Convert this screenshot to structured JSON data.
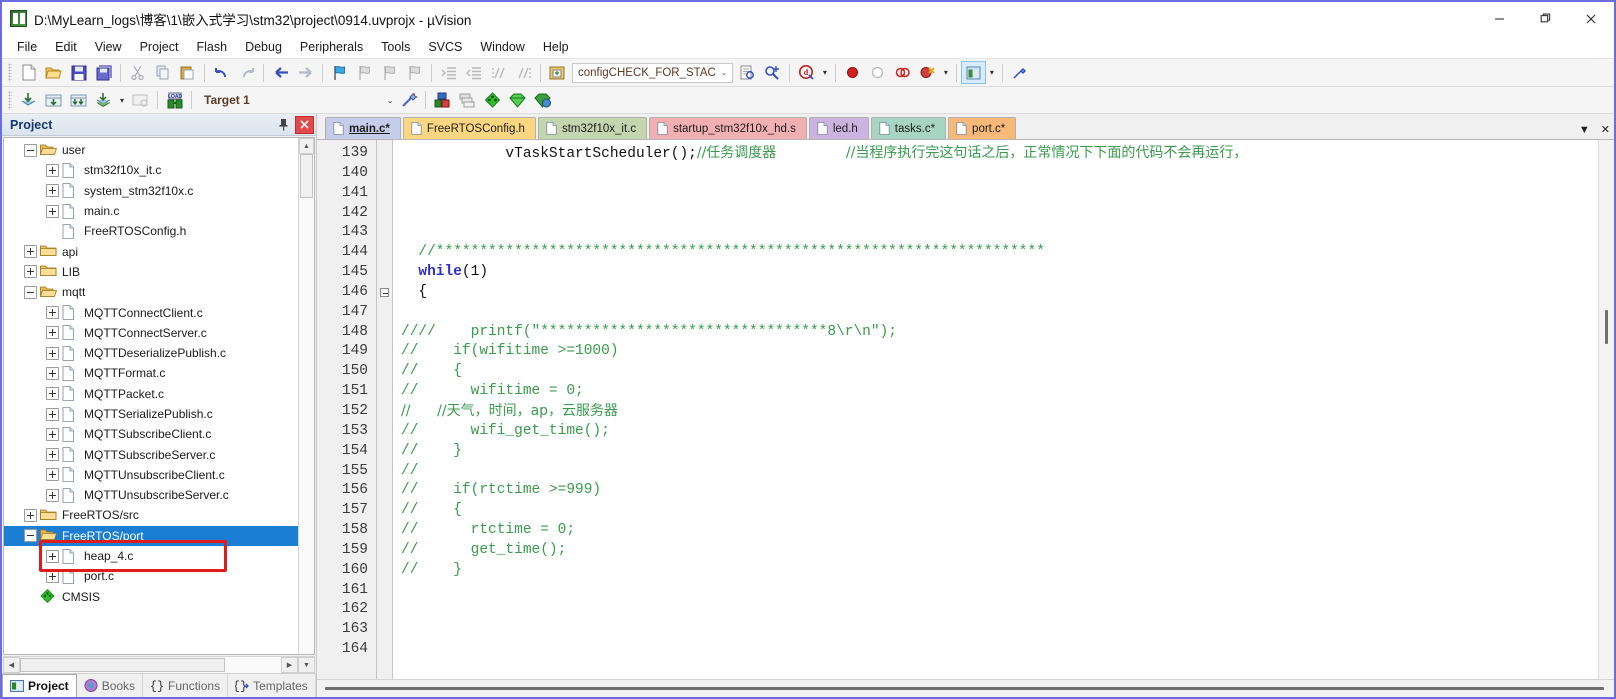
{
  "window": {
    "title": "D:\\MyLearn_logs\\博客\\1\\嵌入式学习\\stm32\\project\\0914.uvprojx - µVision",
    "app_icon": "uvision-icon",
    "minimize": "—",
    "maximize": "❐",
    "close": "✕"
  },
  "menubar": {
    "items": [
      "File",
      "Edit",
      "View",
      "Project",
      "Flash",
      "Debug",
      "Peripherals",
      "Tools",
      "SVCS",
      "Window",
      "Help"
    ]
  },
  "toolbar": {
    "combo_value": "configCHECK_FOR_STAC",
    "combo_arrow": "⌄",
    "target_value": "Target 1",
    "target_arrow": "⌄"
  },
  "project_panel": {
    "title": "Project",
    "pin_icon": "pin-icon",
    "close_icon": "close-icon",
    "tabs": [
      {
        "label": "Project",
        "icon": "project-icon",
        "active": true
      },
      {
        "label": "Books",
        "icon": "books-icon",
        "active": false
      },
      {
        "label": "Functions",
        "icon": "functions-icon",
        "active": false
      },
      {
        "label": "Templates",
        "icon": "templates-icon",
        "active": false
      }
    ],
    "tree": [
      {
        "label": "user",
        "type": "folder",
        "depth": 1,
        "state": "expanded",
        "selected": false
      },
      {
        "label": "stm32f10x_it.c",
        "type": "file",
        "depth": 2,
        "state": "collapsed",
        "selected": false
      },
      {
        "label": "system_stm32f10x.c",
        "type": "file",
        "depth": 2,
        "state": "collapsed",
        "selected": false
      },
      {
        "label": "main.c",
        "type": "file",
        "depth": 2,
        "state": "collapsed",
        "selected": false
      },
      {
        "label": "FreeRTOSConfig.h",
        "type": "file",
        "depth": 2,
        "state": "leaf",
        "selected": false
      },
      {
        "label": "api",
        "type": "folder",
        "depth": 1,
        "state": "collapsed",
        "selected": false
      },
      {
        "label": "LIB",
        "type": "folder",
        "depth": 1,
        "state": "collapsed",
        "selected": false
      },
      {
        "label": "mqtt",
        "type": "folder",
        "depth": 1,
        "state": "expanded",
        "selected": false
      },
      {
        "label": "MQTTConnectClient.c",
        "type": "file",
        "depth": 2,
        "state": "collapsed",
        "selected": false
      },
      {
        "label": "MQTTConnectServer.c",
        "type": "file",
        "depth": 2,
        "state": "collapsed",
        "selected": false
      },
      {
        "label": "MQTTDeserializePublish.c",
        "type": "file",
        "depth": 2,
        "state": "collapsed",
        "selected": false
      },
      {
        "label": "MQTTFormat.c",
        "type": "file",
        "depth": 2,
        "state": "collapsed",
        "selected": false
      },
      {
        "label": "MQTTPacket.c",
        "type": "file",
        "depth": 2,
        "state": "collapsed",
        "selected": false
      },
      {
        "label": "MQTTSerializePublish.c",
        "type": "file",
        "depth": 2,
        "state": "collapsed",
        "selected": false
      },
      {
        "label": "MQTTSubscribeClient.c",
        "type": "file",
        "depth": 2,
        "state": "collapsed",
        "selected": false
      },
      {
        "label": "MQTTSubscribeServer.c",
        "type": "file",
        "depth": 2,
        "state": "collapsed",
        "selected": false
      },
      {
        "label": "MQTTUnsubscribeClient.c",
        "type": "file",
        "depth": 2,
        "state": "collapsed",
        "selected": false
      },
      {
        "label": "MQTTUnsubscribeServer.c",
        "type": "file",
        "depth": 2,
        "state": "collapsed",
        "selected": false
      },
      {
        "label": "FreeRTOS/src",
        "type": "folder",
        "depth": 1,
        "state": "collapsed",
        "selected": false
      },
      {
        "label": "FreeRTOS/port",
        "type": "folder",
        "depth": 1,
        "state": "expanded",
        "selected": true
      },
      {
        "label": "heap_4.c",
        "type": "file",
        "depth": 2,
        "state": "collapsed",
        "selected": false,
        "annotated": true
      },
      {
        "label": "port.c",
        "type": "file",
        "depth": 2,
        "state": "collapsed",
        "selected": false
      },
      {
        "label": "CMSIS",
        "type": "cmsis",
        "depth": 1,
        "state": "leaf",
        "selected": false
      }
    ]
  },
  "editor": {
    "tabs": [
      {
        "label": "main.c*",
        "color": "#c6cdea",
        "active": true
      },
      {
        "label": "FreeRTOSConfig.h",
        "color": "#fcd681",
        "active": false
      },
      {
        "label": "stm32f10x_it.c",
        "color": "#c3d6b0",
        "active": false
      },
      {
        "label": "startup_stm32f10x_hd.s",
        "color": "#f3b0b3",
        "active": false
      },
      {
        "label": "led.h",
        "color": "#ccb3e0",
        "active": false
      },
      {
        "label": "tasks.c*",
        "color": "#a8d4c4",
        "active": false
      },
      {
        "label": "port.c*",
        "color": "#f7b878",
        "active": false
      }
    ],
    "tabstrip_dropdown": "▼",
    "tabstrip_close": "✕",
    "first_line_number": 139,
    "lines": [
      {
        "n": 139,
        "fold": false,
        "tokens": [
          {
            "t": "            ",
            "c": "txt"
          },
          {
            "t": "vTaskStartScheduler();",
            "c": "txt"
          },
          {
            "t": "//任务调度器",
            "c": "cmt"
          },
          {
            "t": "        ",
            "c": "txt"
          },
          {
            "t": "//当程序执行完这句话之后，正常情况下下面的代码不会再运行，",
            "c": "cmt"
          }
        ]
      },
      {
        "n": 140,
        "fold": false,
        "tokens": []
      },
      {
        "n": 141,
        "fold": false,
        "tokens": []
      },
      {
        "n": 142,
        "fold": false,
        "tokens": []
      },
      {
        "n": 143,
        "fold": false,
        "tokens": []
      },
      {
        "n": 144,
        "fold": false,
        "tokens": [
          {
            "t": "  //**********************************************************************",
            "c": "cmt"
          }
        ]
      },
      {
        "n": 145,
        "fold": false,
        "tokens": [
          {
            "t": "  ",
            "c": "txt"
          },
          {
            "t": "while",
            "c": "kw"
          },
          {
            "t": "(1)",
            "c": "txt"
          }
        ]
      },
      {
        "n": 146,
        "fold": true,
        "tokens": [
          {
            "t": "  {",
            "c": "txt"
          }
        ]
      },
      {
        "n": 147,
        "fold": false,
        "tokens": []
      },
      {
        "n": 148,
        "fold": false,
        "tokens": [
          {
            "t": "////    printf(\"*********************************8\\r\\n\");",
            "c": "cmt"
          }
        ]
      },
      {
        "n": 149,
        "fold": false,
        "tokens": [
          {
            "t": "//    if(wifitime >=1000)",
            "c": "cmt"
          }
        ]
      },
      {
        "n": 150,
        "fold": false,
        "tokens": [
          {
            "t": "//    {",
            "c": "cmt"
          }
        ]
      },
      {
        "n": 151,
        "fold": false,
        "tokens": [
          {
            "t": "//      wifitime = 0;",
            "c": "cmt"
          }
        ]
      },
      {
        "n": 152,
        "fold": false,
        "tokens": [
          {
            "t": "//      //天气，时间，ap，云服务器",
            "c": "cmt"
          }
        ]
      },
      {
        "n": 153,
        "fold": false,
        "tokens": [
          {
            "t": "//      wifi_get_time();",
            "c": "cmt"
          }
        ]
      },
      {
        "n": 154,
        "fold": false,
        "tokens": [
          {
            "t": "//    }",
            "c": "cmt"
          }
        ]
      },
      {
        "n": 155,
        "fold": false,
        "tokens": [
          {
            "t": "//",
            "c": "cmt"
          }
        ]
      },
      {
        "n": 156,
        "fold": false,
        "tokens": [
          {
            "t": "//    if(rtctime >=999)",
            "c": "cmt"
          }
        ]
      },
      {
        "n": 157,
        "fold": false,
        "tokens": [
          {
            "t": "//    {",
            "c": "cmt"
          }
        ]
      },
      {
        "n": 158,
        "fold": false,
        "tokens": [
          {
            "t": "//      rtctime = 0;",
            "c": "cmt"
          }
        ]
      },
      {
        "n": 159,
        "fold": false,
        "tokens": [
          {
            "t": "//      get_time();",
            "c": "cmt"
          }
        ]
      },
      {
        "n": 160,
        "fold": false,
        "tokens": [
          {
            "t": "//    }",
            "c": "cmt"
          }
        ]
      },
      {
        "n": 161,
        "fold": false,
        "tokens": []
      },
      {
        "n": 162,
        "fold": false,
        "tokens": []
      },
      {
        "n": 163,
        "fold": false,
        "tokens": []
      },
      {
        "n": 164,
        "fold": false,
        "tokens": []
      }
    ]
  },
  "colors": {
    "comment": "#3a9b4e",
    "keyword": "#2e2ec9",
    "text": "#111111",
    "selection": "#1a7fd4",
    "annotation": "#e01b1b",
    "window_border": "#6b6ce0"
  }
}
